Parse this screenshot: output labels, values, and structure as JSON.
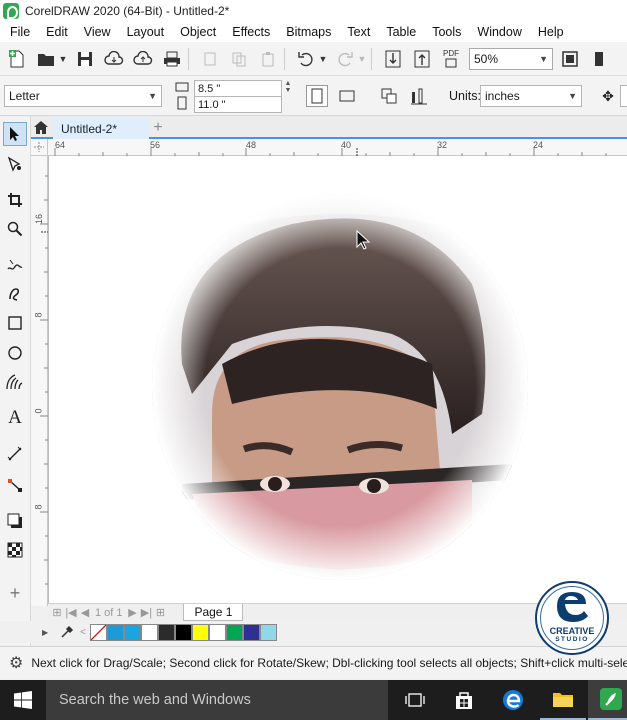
{
  "window": {
    "title": "CorelDRAW 2020 (64-Bit) - Untitled-2*"
  },
  "menu": {
    "items": [
      "File",
      "Edit",
      "View",
      "Layout",
      "Object",
      "Effects",
      "Bitmaps",
      "Text",
      "Table",
      "Tools",
      "Window",
      "Help"
    ]
  },
  "toolbar": {
    "zoom": "50%",
    "pdf_label": "PDF"
  },
  "property_bar": {
    "page_size": "Letter",
    "width": "8.5 \"",
    "height": "11.0 \"",
    "units_label": "Units:",
    "units_value": "inches"
  },
  "document": {
    "tab_label": "Untitled-2*",
    "add_tab": "+"
  },
  "rulers": {
    "horizontal": [
      "64",
      "56",
      "48",
      "40",
      "32",
      "24"
    ],
    "vertical": [
      "16",
      "8",
      "0",
      "8"
    ]
  },
  "page_nav": {
    "current": "1",
    "of_label": "of",
    "total": "1",
    "page_tab": "Page 1"
  },
  "palette": {
    "colors": [
      "#1e9ad6",
      "#18a5e0",
      "#ffffff",
      "#2b2b2b",
      "#000000",
      "#ffff00",
      "#ffffff",
      "#00a651",
      "#2e3192",
      "#8ed8e8"
    ]
  },
  "status": {
    "text": "Next click for Drag/Scale; Second click for Rotate/Skew; Dbl-clicking tool selects all objects; Shift+click multi-sele"
  },
  "taskbar": {
    "search_placeholder": "Search the web and Windows"
  },
  "watermark": {
    "text_line1": "CREATIVE",
    "text_line2": "STUDIO"
  }
}
